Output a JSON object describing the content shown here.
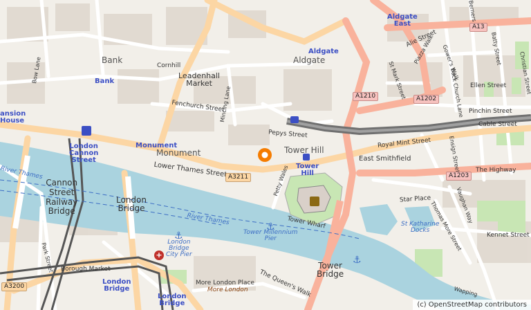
{
  "map": {
    "attribution": "(c) OpenStreetMap contributors",
    "colors": {
      "land": "#f2efe9",
      "water": "#aad3df",
      "primary_road": "#fcd6a4",
      "trunk_road": "#f9b29c",
      "minor_road": "#ffffff",
      "park": "#c8e6b4",
      "building": "#d9d0c9",
      "marker": "#f57c00"
    },
    "places": {
      "bank": "Bank",
      "aldgate": "Aldgate",
      "leadenhall": "Leadenhall\nMarket",
      "monument": "Monument",
      "tower_hill": "Tower Hill",
      "london_bridge": "London\nBridge",
      "cannon_street": "Cannon\nStreet\nRailway\nBridge",
      "tower_bridge": "Tower\nBridge",
      "east_smithfield": "East Smithfield",
      "mansion_house": "ansion\nHouse"
    },
    "stations": {
      "aldgate_east": "Aldgate\nEast",
      "aldgate": "Aldgate",
      "bank": "Bank",
      "monument": "Monument",
      "london_cannon": "London\nCannon\nStreet",
      "tower_hill": "Tower\nHill",
      "london_bridge": "London\nBridge",
      "london_bridge2": "London\nBridge"
    },
    "streets": {
      "cornhill": "Cornhill",
      "fenchurch": "Fenchurch Street",
      "pepys": "Pepys Street",
      "lower_thames": "Lower Thames Street",
      "royal_mint": "Royal Mint Street",
      "cable": "Cable Street",
      "the_highway": "The Highway",
      "alie": "Alie Street",
      "star_place": "Star Place",
      "tower_wharf": "Tower Wharf",
      "borough_market": "Borough Market",
      "more_london_place": "More London Place",
      "queens_walk": "The Queen's Walk",
      "ellen": "Ellen Street",
      "pinchin": "Pinchin Street",
      "kennet": "Kennet Street",
      "mincing": "Mincing Lane",
      "petty_wales": "Petty Wales",
      "bow_lane": "Bow Lane",
      "park_st": "Park Street",
      "st_mark": "St Mark Street",
      "back_church": "Back Church Lane",
      "vaughan": "Vaughan Way",
      "thomas_more": "Thomas More Street",
      "ensign": "Ensign Street",
      "piazza_walk": "Piazza Walk",
      "gowers_walk": "Gower's Walk",
      "batty": "Batty Street",
      "christian": "Christian Street",
      "berners": "Berners",
      "wapping": "Wapping"
    },
    "water_labels": {
      "river_thames": "River Thames",
      "river_thames2": "River Thames",
      "tower_pier": "Tower Millennium\nPier",
      "lb_pier": "London\nBridge\nCity Pier",
      "st_katharine": "St Katharine\nDocks"
    },
    "road_refs": {
      "a13": "A13",
      "a1210": "A1210",
      "a1202": "A1202",
      "a3211": "A3211",
      "a1203": "A1203",
      "a3200": "A3200"
    },
    "poi": {
      "more_london": "More London"
    },
    "marker_label": "location-pin"
  }
}
